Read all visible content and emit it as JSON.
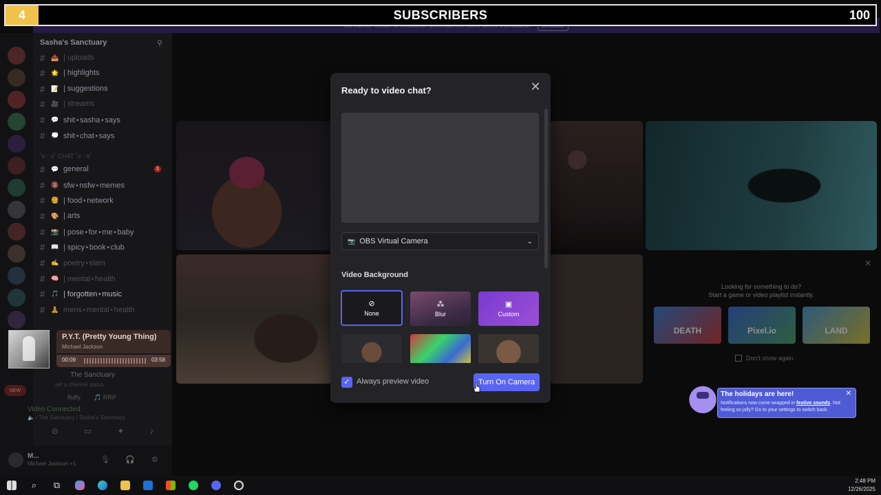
{
  "overlay": {
    "left_count": "4",
    "title": "SUBSCRIBERS",
    "right_count": "100"
  },
  "streamer_banner": {
    "text": "Streamer Mode is enabled. Usernames have been truncated.",
    "button": "Disable"
  },
  "sidebar": {
    "server_name": "Sasha's Sanctuary",
    "channels": [
      {
        "emoji": "📤",
        "label": "| uploads",
        "state": "dim"
      },
      {
        "emoji": "🌟",
        "label": "| highlights",
        "state": "normal"
      },
      {
        "emoji": "📝",
        "label": "| suggestions",
        "state": "normal"
      },
      {
        "emoji": "🎥",
        "label": "| streams",
        "state": "dim"
      },
      {
        "emoji": "💬",
        "label": "shit⋆sasha⋆says",
        "state": "normal"
      },
      {
        "emoji": "💭",
        "label": "shit⋆chat⋆says",
        "state": "normal"
      },
      {
        "emoji": "💬",
        "label": "general",
        "state": "normal",
        "badge": "1"
      },
      {
        "emoji": "🔞",
        "label": "sfw⋆nsfw⋆memes",
        "state": "normal"
      },
      {
        "emoji": "🍔",
        "label": "| food⋆network",
        "state": "normal"
      },
      {
        "emoji": "🎨",
        "label": "| arts",
        "state": "normal"
      },
      {
        "emoji": "📸",
        "label": "| pose⋆for⋆me⋆baby",
        "state": "normal"
      },
      {
        "emoji": "📖",
        "label": "| spicy⋆book⋆club",
        "state": "normal"
      },
      {
        "emoji": "✍",
        "label": "poetry⋆slam",
        "state": "dim"
      },
      {
        "emoji": "🧠",
        "label": "| mental⋆health",
        "state": "dim"
      },
      {
        "emoji": "🎵",
        "label": "| forgotten⋆music",
        "state": "bright"
      },
      {
        "emoji": "🧘",
        "label": "mens⋆mental⋆health",
        "state": "dim"
      }
    ],
    "category_divider": "˚ʚ♡ɞ˚ CHAT ˚ʚ♡ɞ˚"
  },
  "music": {
    "title": "P.Y.T. (Pretty Young Thing)",
    "artist": "Michael Jackson",
    "elapsed": "00:09",
    "duration": "03:58"
  },
  "voice": {
    "channel_name": "The Sanctuary",
    "channel_sub": "set a channel status",
    "member": "fluffy",
    "member_tag": "🎵 RRP",
    "connected": "Video Connected",
    "connected_sub": "🔈 / The Sanctuary / Sasha's Sanctuary",
    "new_badge": "NEW"
  },
  "user_panel": {
    "name": "M...",
    "status": "Michael Jackson +1"
  },
  "activity": {
    "line1": "Looking for something to do?",
    "line2": "Start a game or video playlist instantly.",
    "games": [
      "DEATH",
      "Pixel.io",
      "LAND"
    ],
    "dont_show": "Don't show again"
  },
  "modal": {
    "title": "Ready to video chat?",
    "device": "OBS Virtual Camera",
    "bg_heading": "Video Background",
    "bg_options": [
      "None",
      "Blur",
      "Custom"
    ],
    "always_preview": "Always preview video",
    "turn_on": "Turn On Camera"
  },
  "toast": {
    "title": "The holidays are here!",
    "msg_pre": "Notifications now come wrapped in ",
    "msg_link": "festive sounds",
    "msg_post": ". Not feeling so jolly? Go to your settings to switch back."
  },
  "taskbar": {
    "time": "2:48 PM",
    "date": "12/26/2025"
  },
  "colors": {
    "accent": "#5865f2",
    "overlay_gold": "#f0c24b",
    "custom_purple": "#9b4fd6"
  }
}
